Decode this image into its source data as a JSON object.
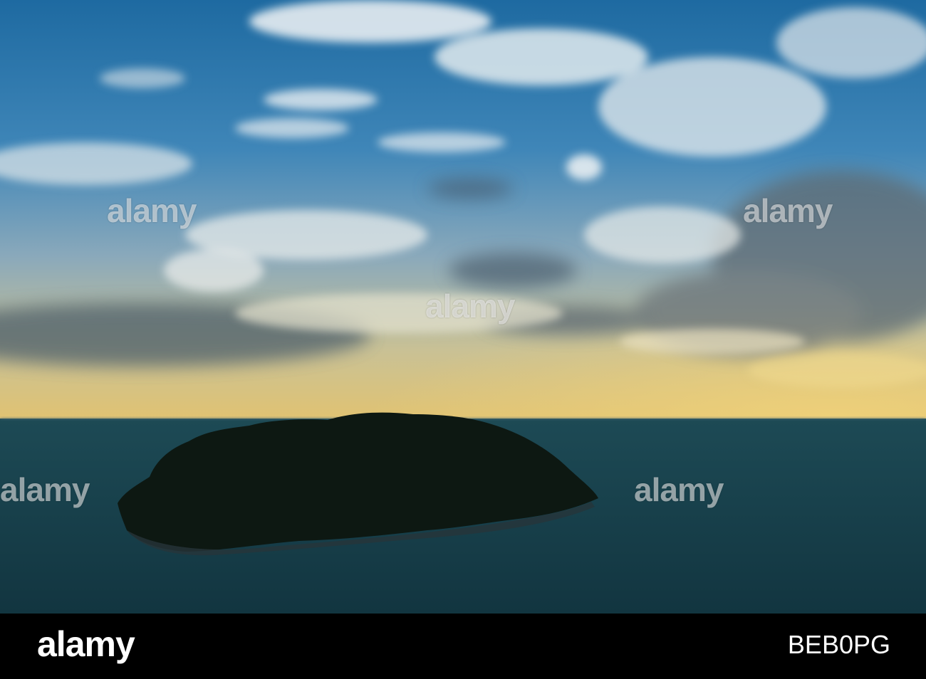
{
  "photo": {
    "colors": {
      "sky_top": "#1f6fa6",
      "sky_mid": "#4e8fbd",
      "horizon_glow": "#e6c56c",
      "sea": "#163f4b",
      "sea_deep": "#0f2e38",
      "island": "#0f1a12",
      "cloud": "#eef2f4"
    }
  },
  "watermarks": [
    "alamy",
    "alamy",
    "alamy",
    "alamy",
    "alamy"
  ],
  "footer": {
    "logo": "alamy",
    "image_id": "BEB0PG"
  }
}
